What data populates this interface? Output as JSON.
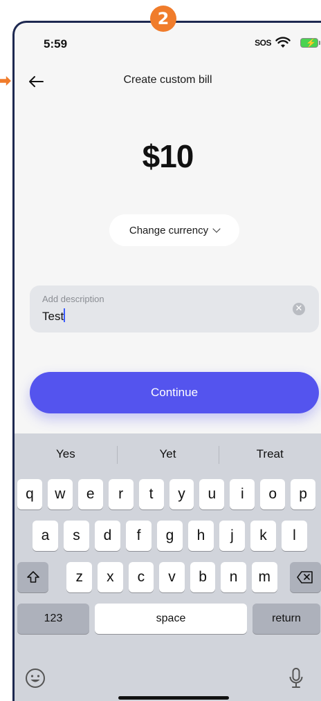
{
  "annotation": {
    "step": "2"
  },
  "status_bar": {
    "time": "5:59",
    "signal": "SOS"
  },
  "nav": {
    "title": "Create custom bill"
  },
  "bill": {
    "amount": "$10",
    "currency_button": "Change currency",
    "description_placeholder": "Add description",
    "description_value": "Test",
    "continue_label": "Continue"
  },
  "keyboard": {
    "suggestions": [
      "Yes",
      "Yet",
      "Treat"
    ],
    "row1": [
      "q",
      "w",
      "e",
      "r",
      "t",
      "y",
      "u",
      "i",
      "o",
      "p"
    ],
    "row2": [
      "a",
      "s",
      "d",
      "f",
      "g",
      "h",
      "j",
      "k",
      "l"
    ],
    "row3": [
      "z",
      "x",
      "c",
      "v",
      "b",
      "n",
      "m"
    ],
    "numbers_label": "123",
    "space_label": "space",
    "return_label": "return"
  },
  "colors": {
    "accent": "#5454ee",
    "annotation": "#f07c2b",
    "frame": "#1d2850"
  }
}
